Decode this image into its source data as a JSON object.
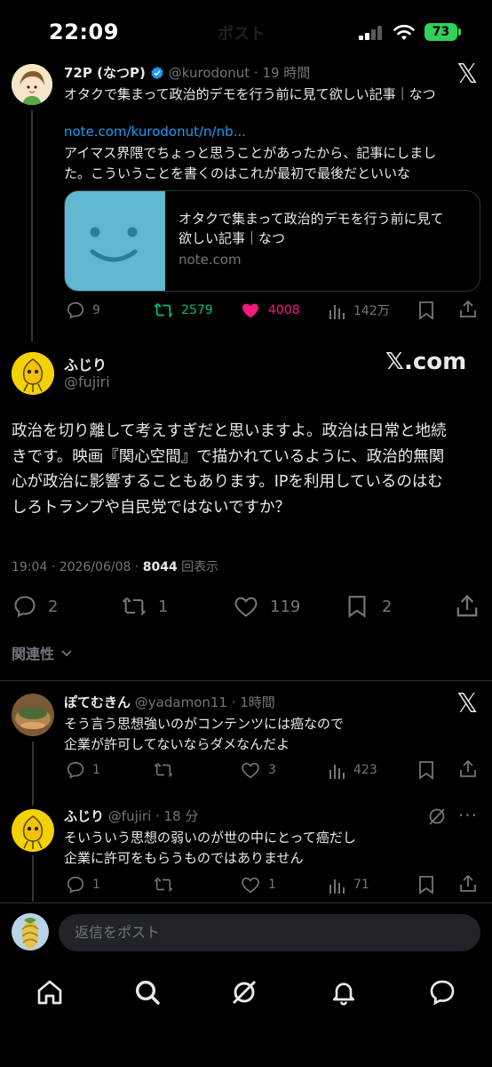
{
  "status_bar": {
    "time": "22:09",
    "faded_title": "ポスト",
    "battery": "73"
  },
  "quoted_tweet": {
    "display_name": "72P (なつP)",
    "handle_time": "@kurodonut · 19 時間",
    "line1": "オタクで集まって政治的デモを行う前に見て欲しい記事｜なつ",
    "link": "note.com/kurodonut/n/nb...",
    "line2": "アイマス界隈でちょっと思うことがあったから、記事にしまし",
    "line3": "た。こういうことを書くのはこれが最初で最後だといいな",
    "card": {
      "title1": "オタクで集まって政治的デモを行う前に見て",
      "title2": "欲しい記事｜なつ",
      "domain": "note.com"
    },
    "stats": {
      "replies": "9",
      "reposts": "2579",
      "likes": "4008",
      "views": "142万"
    }
  },
  "main_tweet": {
    "display_name": "ふじり",
    "handle": "@fujiri",
    "site_label": "𝕏.com",
    "text_lines": [
      "政治を切り離して考えすぎだと思いますよ。政治は日常と地続",
      "きです。映画『関心空間』で描かれているように、政治的無関",
      "心が政治に影響することもあります。IPを利用しているのはむ",
      "しろトランプや自民党ではないですか？"
    ],
    "meta_time": "19:04 · 2026/06/08 · ",
    "meta_views": "8044",
    "meta_views_label": " 回表示",
    "stats": {
      "replies": "2",
      "reposts": "1",
      "likes": "119",
      "bookmarks": "2"
    }
  },
  "sort": {
    "label": "関連性"
  },
  "replies": [
    {
      "display_name": "ぽてむきん",
      "handle_time": "@yadamon11 · 1時間",
      "line1": "そう言う思想強いのがコンテンツには癌なので",
      "line2": "企業が許可してないならダメなんだよ",
      "stats": {
        "replies": "1",
        "reposts": "",
        "likes": "3",
        "views": "423"
      }
    },
    {
      "display_name": "ふじり",
      "handle_time": "@fujiri · 18 分",
      "line1": "そいういう思想の弱いのが世の中にとって癌だし",
      "line2": "企業に許可をもらうものではありません",
      "stats": {
        "replies": "1",
        "reposts": "",
        "likes": "1",
        "views": "71"
      }
    }
  ],
  "compose": {
    "placeholder": "返信をポスト"
  },
  "colors": {
    "background": "#000000",
    "link": "#1d9bf0",
    "repost_green": "#00ba7c",
    "like_pink": "#f91880",
    "muted": "#71767b"
  },
  "icons": [
    "x-logo",
    "verified-badge",
    "reply-icon",
    "repost-icon",
    "like-icon",
    "views-icon",
    "bookmark-icon",
    "share-icon",
    "grok-icon",
    "more-icon",
    "home-icon",
    "search-icon",
    "bell-icon",
    "messages-icon"
  ]
}
